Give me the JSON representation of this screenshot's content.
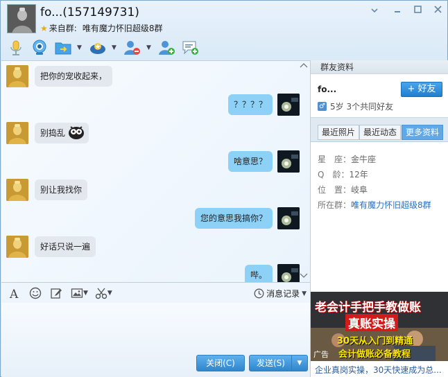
{
  "window": {
    "title": "fo...(157149731)",
    "source_prefix": "来自群:",
    "source_group": "唯有魔力怀旧超级8群"
  },
  "messages": [
    {
      "side": "left",
      "text": "把你的宠收起来，"
    },
    {
      "side": "right",
      "text": "？？？？"
    },
    {
      "side": "left",
      "text": "别捣乱"
    },
    {
      "side": "right",
      "text": "啥意思？"
    },
    {
      "side": "left",
      "text": "别让我找你"
    },
    {
      "side": "right",
      "text": "您的意思我搞你？"
    },
    {
      "side": "left",
      "text": "好话只说一遍"
    },
    {
      "side": "right",
      "text": "哔。"
    }
  ],
  "input_toolbar": {
    "history_label": "消息记录"
  },
  "buttons": {
    "close_label": "关闭(C)",
    "send_label": "发送(S)"
  },
  "panel": {
    "header": "群友资料",
    "name": "fo...",
    "add_friend_label": "+ 好友",
    "age_line": "5岁 3个共同好友",
    "tabs": [
      "最近照片",
      "最近动态",
      "更多资料"
    ],
    "info": [
      {
        "label": "星　座：",
        "value": "金牛座"
      },
      {
        "label": "Q　龄：",
        "value": "12年"
      },
      {
        "label": "位　置：",
        "value": "岐阜"
      },
      {
        "label": "所在群：",
        "value": "唯有魔力怀旧超级8群"
      }
    ]
  },
  "ad": {
    "line1": "老会计手把手教做账",
    "line2": "真账实操",
    "line3": "30天从入门到精通",
    "line4": "会计做账必备教程",
    "tag": "广告",
    "caption": "企业真岗实操，30天快速成为总..."
  },
  "colors": {
    "accent": "#2f86cb",
    "bubble_right": "#8ed1f7",
    "bubble_left": "#e3e8ee"
  }
}
